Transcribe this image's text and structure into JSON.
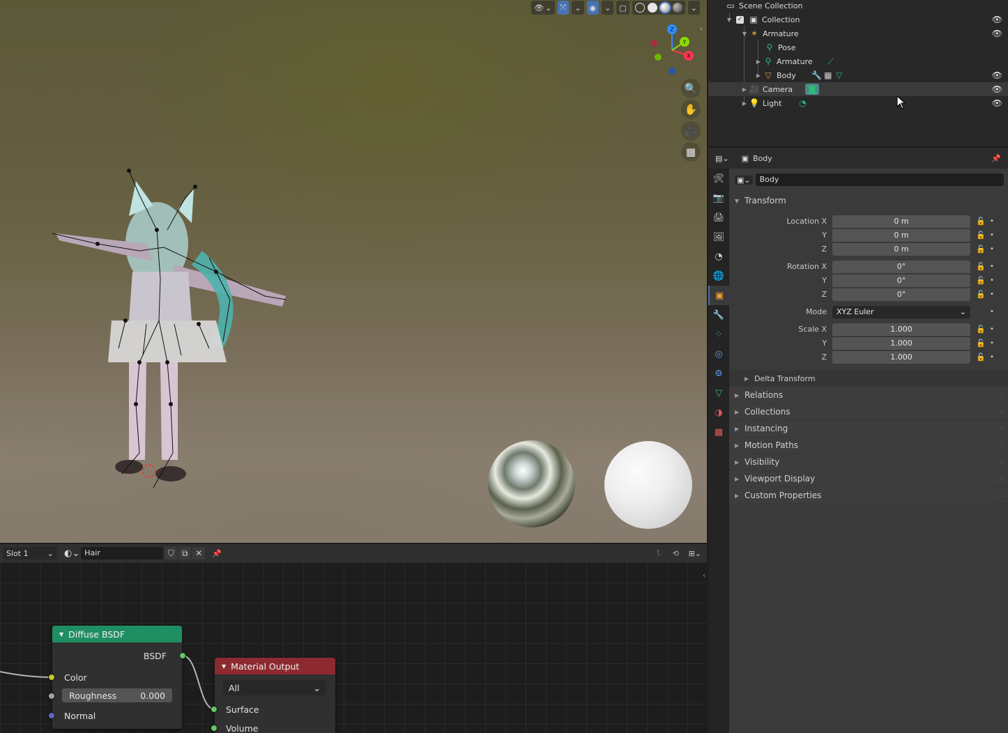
{
  "viewport": {
    "header_icons": [
      "visibility-icon",
      "gizmo-icon",
      "overlay-icon",
      "xray-icon",
      "wireframe-shading",
      "solid-shading",
      "material-shading",
      "rendered-shading"
    ],
    "gizmo_axes": {
      "x": "X",
      "y": "Y",
      "z": "Z"
    },
    "nav_icons": [
      "zoom-icon",
      "pan-hand-icon",
      "camera-icon",
      "grid-icon"
    ]
  },
  "outliner": {
    "rows": [
      {
        "label": "Scene Collection",
        "icon": "scene-collection-icon"
      },
      {
        "label": "Collection",
        "icon": "collection-icon"
      },
      {
        "label": "Armature",
        "icon": "armature-icon"
      },
      {
        "label": "Pose",
        "icon": "pose-icon"
      },
      {
        "label": "Armature",
        "icon": "armature-data-icon"
      },
      {
        "label": "Body",
        "icon": "mesh-icon"
      },
      {
        "label": "Camera",
        "icon": "camera-icon"
      },
      {
        "label": "Light",
        "icon": "light-icon"
      }
    ]
  },
  "properties": {
    "header_object": "Body",
    "object_name": "Body",
    "transform": {
      "title": "Transform",
      "location": {
        "label_x": "Location X",
        "label_y": "Y",
        "label_z": "Z",
        "x": "0 m",
        "y": "0 m",
        "z": "0 m"
      },
      "rotation": {
        "label_x": "Rotation X",
        "label_y": "Y",
        "label_z": "Z",
        "x": "0°",
        "y": "0°",
        "z": "0°"
      },
      "mode": {
        "label": "Mode",
        "value": "XYZ Euler"
      },
      "scale": {
        "label_x": "Scale X",
        "label_y": "Y",
        "label_z": "Z",
        "x": "1.000",
        "y": "1.000",
        "z": "1.000"
      }
    },
    "subpanels": {
      "delta": "Delta Transform",
      "relations": "Relations",
      "collections": "Collections",
      "instancing": "Instancing",
      "motion_paths": "Motion Paths",
      "visibility": "Visibility",
      "viewport_display": "Viewport Display",
      "custom_properties": "Custom Properties"
    }
  },
  "node_editor": {
    "slot": "Slot 1",
    "material": "Hair",
    "diffuse": {
      "title": "Diffuse BSDF",
      "output": "BSDF",
      "color": "Color",
      "roughness_label": "Roughness",
      "roughness_value": "0.000",
      "normal": "Normal"
    },
    "output": {
      "title": "Material Output",
      "target": "All",
      "surface": "Surface",
      "volume": "Volume"
    }
  },
  "colors": {
    "accent": "#4772b3",
    "diffuse_header": "#1f8f63",
    "output_header": "#8c2a30",
    "socket_green": "#63c763",
    "socket_yellow": "#c7c729",
    "socket_grey": "#a1a1a1",
    "socket_blue": "#6363c7"
  }
}
